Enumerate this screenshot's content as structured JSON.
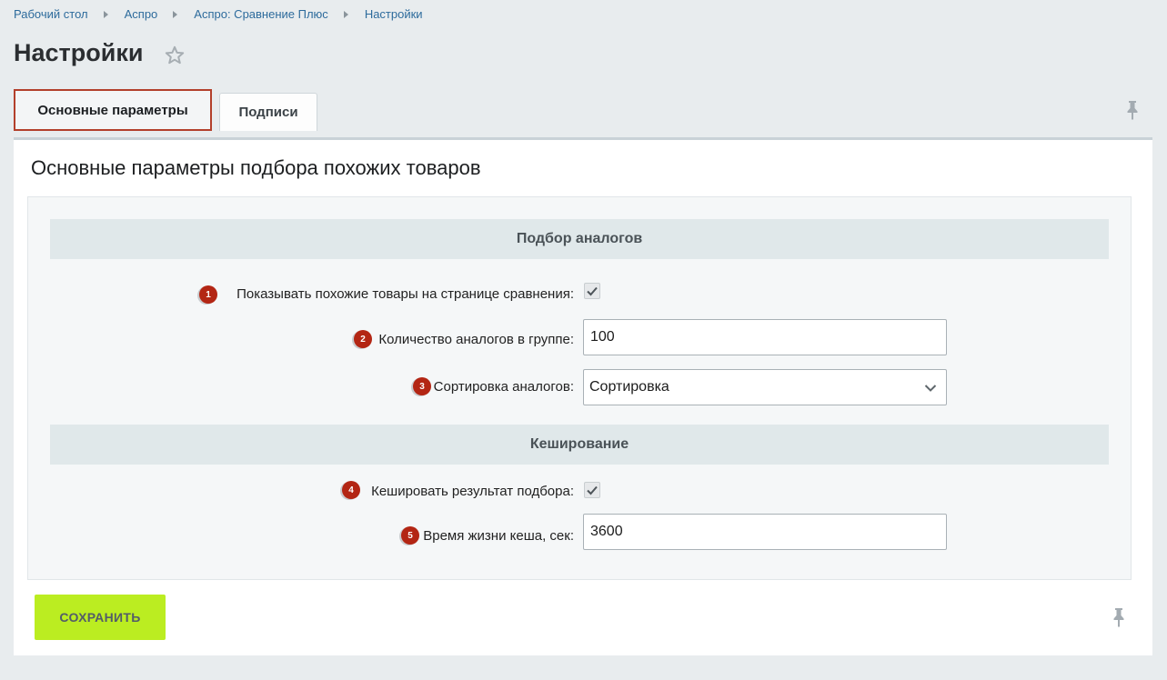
{
  "breadcrumb": [
    {
      "label": "Рабочий стол"
    },
    {
      "label": "Аспро"
    },
    {
      "label": "Аспро: Сравнение Плюс"
    },
    {
      "label": "Настройки"
    }
  ],
  "page": {
    "title": "Настройки"
  },
  "tabs": [
    {
      "label": "Основные параметры",
      "active": true
    },
    {
      "label": "Подписи",
      "active": false
    }
  ],
  "panel": {
    "heading": "Основные параметры подбора похожих товаров"
  },
  "sections": [
    {
      "title": "Подбор аналогов"
    },
    {
      "title": "Кеширование"
    }
  ],
  "fields": [
    {
      "badge": "1",
      "label": "Показывать похожие товары на странице сравнения:",
      "type": "checkbox",
      "checked": true
    },
    {
      "badge": "2",
      "label": "Количество аналогов в группе:",
      "type": "text",
      "value": "100"
    },
    {
      "badge": "3",
      "label": "Сортировка аналогов:",
      "type": "select",
      "value": "Сортировка"
    },
    {
      "badge": "4",
      "label": "Кешировать результат подбора:",
      "type": "checkbox",
      "checked": true
    },
    {
      "badge": "5",
      "label": "Время жизни кеша, сек:",
      "type": "text",
      "value": "3600"
    }
  ],
  "actions": {
    "save_label": "СОХРАНИТЬ"
  },
  "colors": {
    "accent_button": "#bbed21",
    "badge": "#b32614",
    "active_tab_border": "#b3402b",
    "link": "#2d6b9c"
  },
  "icons": {
    "favorite": "star-icon",
    "pin": "pin-icon",
    "dropdown": "chevron-down-icon",
    "check": "check-icon"
  }
}
